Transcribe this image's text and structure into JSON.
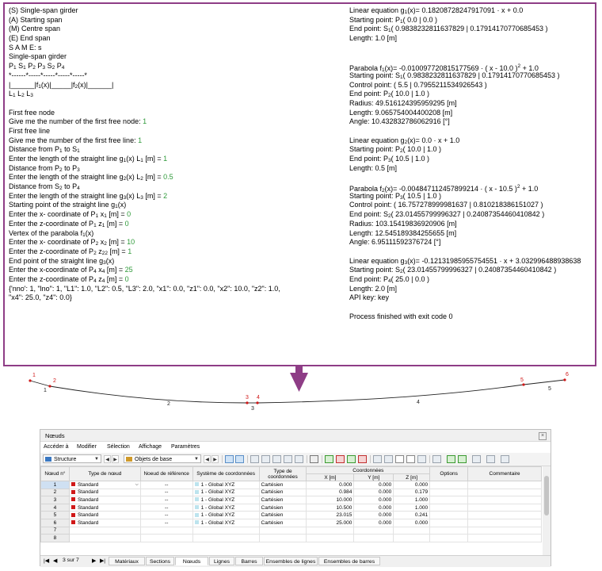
{
  "console": {
    "left": [
      "(S) Single-span girder",
      "(A) Starting span",
      "(M) Centre span",
      "(E) End span",
      "S A M E: s",
      "Single-span girder",
      "P1 S1 P2 P3 S2 P4",
      "*------*-----*-----*-----*-----*",
      "|______|f1(x)|_____|f2(x)|______|",
      " L1 L2 L3",
      "",
      "First free node",
      "Give me the number of the first free node: 1",
      "First free line",
      "Give me the number of the first free line: 1",
      "Distance from P1 to S1",
      "Enter the length of the straight line g1(x) L1 [m] = 1",
      "Distance from P2 to P3",
      "Enter the length of the straight line g2(x) L2 [m] = 0.5",
      "Distance from S2 to P4",
      "Enter the length of the straight line g3(x) L3 [m] = 2",
      "Starting point of the straight line g1(x)",
      "Enter the x- coordinate of P1 x1 [m] = 0",
      "Enter the z-coordinate of P1 z1 [m] = 0",
      "Vertex of the parabola f1(x)",
      "Enter the x- coordinate of P2 x2 [m] = 10",
      "Enter the z-coordinate of P2 z22 [m] = 1",
      "End point of the straight line g3(x)",
      "Enter the x-coordinate of P4 x4 [m] = 25",
      "Enter the z-coordinate of P4 z4 [m] = 0",
      "{'nno': 1, \"lno\": 1, \"L1\": 1.0, \"L2\": 0.5, \"L3\": 2.0, \"x1\": 0.0, \"z1\": 0.0, \"x2\": 10.0, \"z2\": 1.0,",
      "\"x4\": 25.0, \"z4\": 0.0}"
    ],
    "right": [
      "Linear equation g1(x)= 0.18208728247917091 · x + 0.0",
      "Starting point: P1( 0.0 | 0.0 )",
      "End point: S1( 0.9838232811637829 | 0.17914170770685453 )",
      "Length: 1.0 [m]",
      "",
      "",
      "Parabola f1(x)= -0.010097720815177569 · ( x - 10.0 )² + 1.0",
      "Starting point: S1( 0.9838232811637829 | 0.17914170770685453 )",
      "Control point: ( 5.5 | 0.7955211534926543 )",
      "End point: P2( 10.0 | 1.0 )",
      "Radius: 49.516124395959295 [m]",
      "Length: 9.065754004400208 [m]",
      "Angle: 10.432832786062916 [°]",
      "",
      "Linear equation g2(x)= 0.0 · x + 1.0",
      "Starting point: P2( 10.0 | 1.0 )",
      "End point: P3( 10.5 | 1.0 )",
      "Length: 0.5 [m]",
      "",
      "Parabola f2(x)= -0.004847112457899214 · ( x - 10.5 )² + 1.0",
      "Starting point: P3( 10.5 | 1.0 )",
      "Control point: ( 16.757278999981637 | 0.810218386151027 )",
      "End point: S2( 23.01455799996327 | 0.24087354460410842 )",
      "Radius: 103.15419836920906 [m]",
      "Length: 12.545189384255655 [m]",
      "Angle: 6.95111592376724 [°]",
      "",
      "Linear equation g3(x)= -0.12131985955754551 · x + 3.032996488938638",
      "Starting point: S2( 23.01455799996327 | 0.24087354460410842 )",
      "End point: P4( 25.0 | 0.0 )",
      "Length: 2.0 [m]",
      "API key: key",
      "",
      "Process finished with exit code 0"
    ]
  },
  "diagram": {
    "node_labels": [
      "1",
      "2",
      "3",
      "4",
      "5",
      "6"
    ],
    "line_labels": [
      "1",
      "2",
      "3",
      "4",
      "5"
    ],
    "node_color": "#d01818",
    "line_color": "#222222",
    "arrow_color": "#8e3d86"
  },
  "window": {
    "title": "Nœuds",
    "menu": [
      "Accéder à",
      "Modifier",
      "Sélection",
      "Affichage",
      "Paramètres"
    ],
    "combo1": "Structure",
    "combo2": "Objets de base",
    "columns": {
      "num": "Nœud n°",
      "type": "Type de nœud",
      "ref": "Noeud de référence",
      "sys": "Système de coordonnées",
      "ctype": "Type de coordonnées",
      "coords": "Coordonnées",
      "x": "X [m]",
      "y": "Y [m]",
      "z": "Z [m]",
      "opt": "Options",
      "com": "Commentaire"
    },
    "rows": [
      {
        "n": "1",
        "type": "Standard",
        "ref": "--",
        "sys": "1 - Global XYZ",
        "ctype": "Cartésien",
        "x": "0.000",
        "y": "0.000",
        "z": "0.000"
      },
      {
        "n": "2",
        "type": "Standard",
        "ref": "--",
        "sys": "1 - Global XYZ",
        "ctype": "Cartésien",
        "x": "0.984",
        "y": "0.000",
        "z": "0.179"
      },
      {
        "n": "3",
        "type": "Standard",
        "ref": "--",
        "sys": "1 - Global XYZ",
        "ctype": "Cartésien",
        "x": "10.000",
        "y": "0.000",
        "z": "1.000"
      },
      {
        "n": "4",
        "type": "Standard",
        "ref": "--",
        "sys": "1 - Global XYZ",
        "ctype": "Cartésien",
        "x": "10.500",
        "y": "0.000",
        "z": "1.000"
      },
      {
        "n": "5",
        "type": "Standard",
        "ref": "--",
        "sys": "1 - Global XYZ",
        "ctype": "Cartésien",
        "x": "23.015",
        "y": "0.000",
        "z": "0.241"
      },
      {
        "n": "6",
        "type": "Standard",
        "ref": "--",
        "sys": "1 - Global XYZ",
        "ctype": "Cartésien",
        "x": "25.000",
        "y": "0.000",
        "z": "0.000"
      },
      {
        "n": "7",
        "type": "",
        "ref": "",
        "sys": "",
        "ctype": "",
        "x": "",
        "y": "",
        "z": ""
      },
      {
        "n": "8",
        "type": "",
        "ref": "",
        "sys": "",
        "ctype": "",
        "x": "",
        "y": "",
        "z": ""
      }
    ],
    "pager": "3 sur 7",
    "tabs": [
      "Matériaux",
      "Sections",
      "Nœuds",
      "Lignes",
      "Barres",
      "Ensembles de lignes",
      "Ensembles de barres"
    ],
    "active_tab": "Nœuds"
  }
}
